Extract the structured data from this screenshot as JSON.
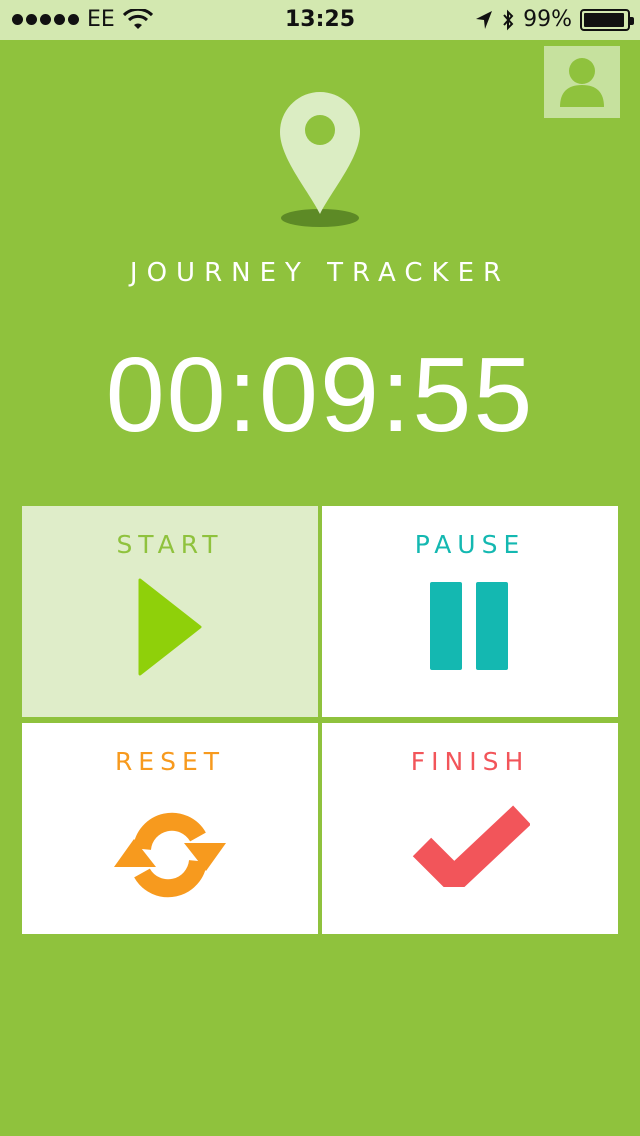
{
  "status_bar": {
    "carrier": "EE",
    "time": "13:25",
    "battery": "99%"
  },
  "app": {
    "title": "JOURNEY TRACKER",
    "timer": "00:09:55"
  },
  "controls": {
    "start_label": "START",
    "pause_label": "PAUSE",
    "reset_label": "RESET",
    "finish_label": "FINISH"
  },
  "colors": {
    "background": "#8fc23d",
    "start": "#8fc23d",
    "pause": "#14b8b1",
    "reset": "#f79a1e",
    "finish": "#f2555a"
  },
  "icons": {
    "profile": "person-icon",
    "location": "map-pin-icon",
    "start": "play-icon",
    "pause": "pause-icon",
    "reset": "refresh-icon",
    "finish": "checkmark-icon"
  }
}
